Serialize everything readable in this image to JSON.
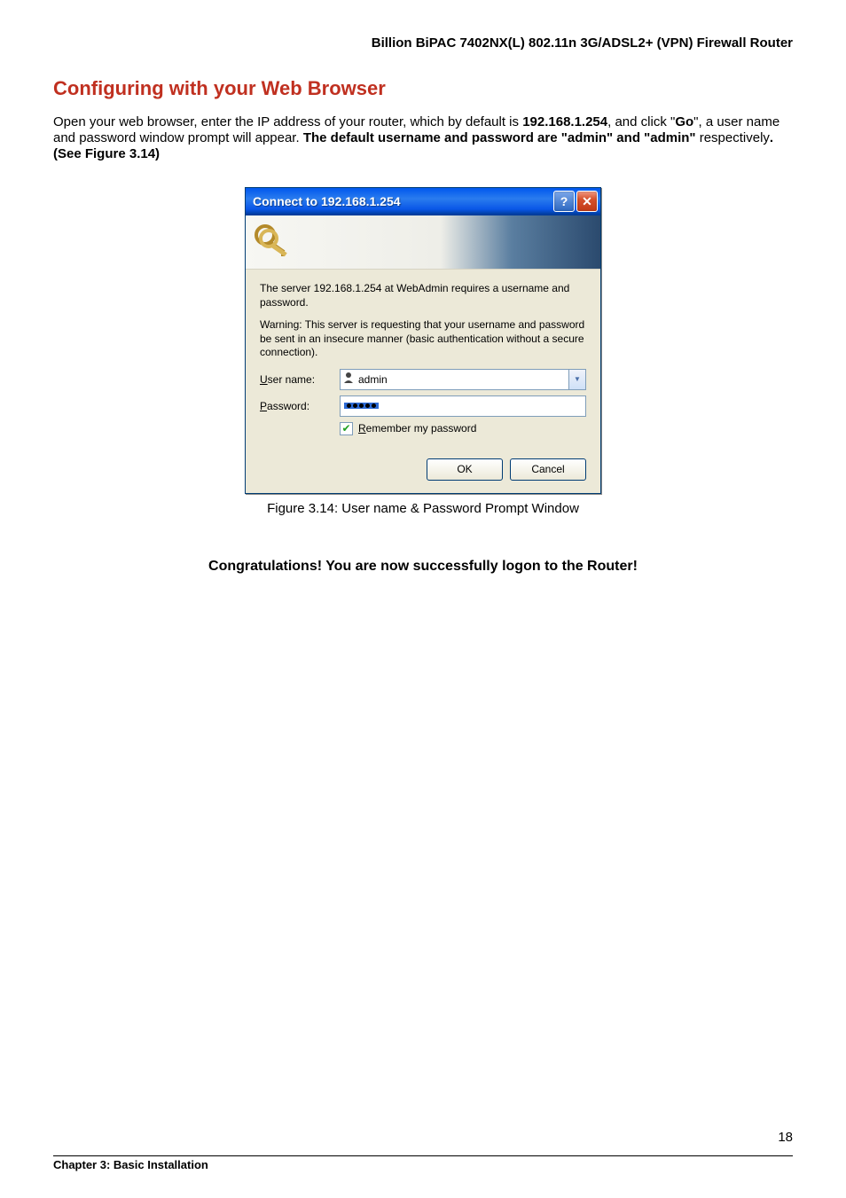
{
  "header": {
    "product_line": "Billion BiPAC 7402NX(L) 802.11n 3G/ADSL2+ (VPN) Firewall Router"
  },
  "heading": "Configuring with your Web Browser",
  "paragraph": {
    "p1_a": "Open your web browser, enter the IP address of your router, which by default is ",
    "ip": "192.168.1.254",
    "p1_b": ", and click \"",
    "go": "Go",
    "p1_c": "\", a user name and password window prompt will appear.    ",
    "p1_d": "The default username and password are \"admin\" and \"admin\"",
    "p1_e": " respectively",
    "p1_f": ". (See Figure 3.14)"
  },
  "dialog": {
    "title": "Connect to 192.168.1.254",
    "message1": "The server 192.168.1.254 at WebAdmin requires a username and password.",
    "message2": "Warning: This server is requesting that your username and password be sent in an insecure manner (basic authentication without a secure connection).",
    "username_label_pre": "U",
    "username_label_post": "ser name:",
    "username_value": "admin",
    "password_label_pre": "P",
    "password_label_post": "assword:",
    "password_value": "•••••",
    "remember_pre": "R",
    "remember_post": "emember my password",
    "ok": "OK",
    "cancel": "Cancel"
  },
  "caption": "Figure 3.14: User name & Password Prompt Window",
  "congrats": "Congratulations! You are now successfully logon to the Router!",
  "footer": {
    "chapter": "Chapter 3: Basic Installation",
    "page": "18"
  }
}
